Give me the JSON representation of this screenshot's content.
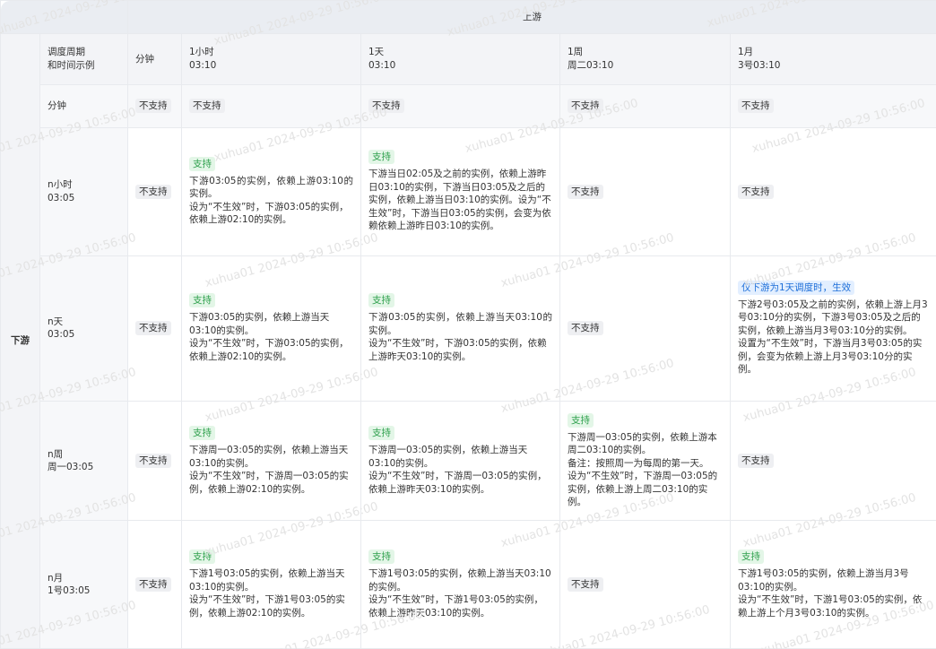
{
  "header": {
    "upstream_label": "上游",
    "downstream_label": "下游",
    "axis_label_line1": "调度周期",
    "axis_label_line2": "和时间示例"
  },
  "columns": [
    {
      "freq": "分钟",
      "time": ""
    },
    {
      "freq": "1小时",
      "time": "03:10"
    },
    {
      "freq": "1天",
      "time": "03:10"
    },
    {
      "freq": "1周",
      "time": "周二03:10"
    },
    {
      "freq": "1月",
      "time": "3号03:10"
    }
  ],
  "rows": [
    {
      "label1": "分钟",
      "label2": "",
      "cells": [
        {
          "status": "不支持"
        },
        {
          "status": "不支持"
        },
        {
          "status": "不支持"
        },
        {
          "status": "不支持"
        },
        {
          "status": "不支持"
        }
      ]
    },
    {
      "label1": "n小时",
      "label2": "03:05",
      "cells": [
        {
          "status": "不支持"
        },
        {
          "status": "支持",
          "lines": [
            "下游03:05的实例，依赖上游03:10的实例。",
            "设为“不生效”时，下游03:05的实例，依赖上游02:10的实例。"
          ]
        },
        {
          "status": "支持",
          "lines": [
            "下游当日02:05及之前的实例，依赖上游昨日03:10的实例，下游当日03:05及之后的实例，依赖上游当日03:10的实例。设为“不生效”时，下游当日03:05的实例，会变为依赖依赖上游昨日03:10的实例。"
          ]
        },
        {
          "status": "不支持"
        },
        {
          "status": "不支持"
        }
      ]
    },
    {
      "label1": "n天",
      "label2": "03:05",
      "cells": [
        {
          "status": "不支持"
        },
        {
          "status": "支持",
          "lines": [
            "下游03:05的实例，依赖上游当天03:10的实例。",
            "设为“不生效”时，下游03:05的实例，依赖上游02:10的实例。"
          ]
        },
        {
          "status": "支持",
          "lines": [
            "下游03:05的实例，依赖上游当天03:10的实例。",
            "设为“不生效”时，下游03:05的实例，依赖上游昨天03:10的实例。"
          ]
        },
        {
          "status": "不支持"
        },
        {
          "status": "仅下游为1天调度时，生效",
          "lines": [
            "下游2号03:05及之前的实例，依赖上游上月3号03:10分的实例，下游3号03:05及之后的实例，依赖上游当月3号03:10分的实例。",
            "设置为“不生效”时，下游当月3号03:05的实例，会变为依赖上游上月3号03:10分的实例。"
          ]
        }
      ]
    },
    {
      "label1": "n周",
      "label2": "周一03:05",
      "cells": [
        {
          "status": "不支持"
        },
        {
          "status": "支持",
          "lines": [
            "下游周一03:05的实例，依赖上游当天03:10的实例。",
            "设为“不生效”时，下游周一03:05的实例，依赖上游02:10的实例。"
          ]
        },
        {
          "status": "支持",
          "lines": [
            "下游周一03:05的实例，依赖上游当天03:10的实例。",
            "设为“不生效”时，下游周一03:05的实例，依赖上游昨天03:10的实例。"
          ]
        },
        {
          "status": "支持",
          "lines": [
            "下游周一03:05的实例，依赖上游本周二03:10的实例。",
            "备注：按照周一为每周的第一天。",
            "设为“不生效”时，下游周一03:05的实例，依赖上游上周二03:10的实例。"
          ]
        },
        {
          "status": "不支持"
        }
      ]
    },
    {
      "label1": "n月",
      "label2": "1号03:05",
      "cells": [
        {
          "status": "不支持"
        },
        {
          "status": "支持",
          "lines": [
            "下游1号03:05的实例，依赖上游当天03:10的实例。",
            "设为“不生效”时，下游1号03:05的实例，依赖上游02:10的实例。"
          ]
        },
        {
          "status": "支持",
          "lines": [
            "下游1号03:05的实例，依赖上游当天03:10的实例。",
            "设为“不生效”时，下游1号03:05的实例，依赖上游昨天03:10的实例。"
          ]
        },
        {
          "status": "不支持"
        },
        {
          "status": "支持",
          "lines": [
            "下游1号03:05的实例，依赖上游当月3号03:10的实例。",
            "设为“不生效”时，下游1号03:05的实例，依赖上游上个月3号03:10的实例。"
          ]
        }
      ]
    }
  ],
  "watermark": {
    "text": "xuhua01 2024-09-29 10:56:00",
    "color": "#e3e3e3"
  },
  "colors": {
    "header_bg": "#eaedf2",
    "yes_bg": "#e3f6e7",
    "yes_fg": "#2ea04c",
    "no_bg": "#eeeff2",
    "cond_bg": "#e3efff",
    "cond_fg": "#1e6fd9"
  }
}
